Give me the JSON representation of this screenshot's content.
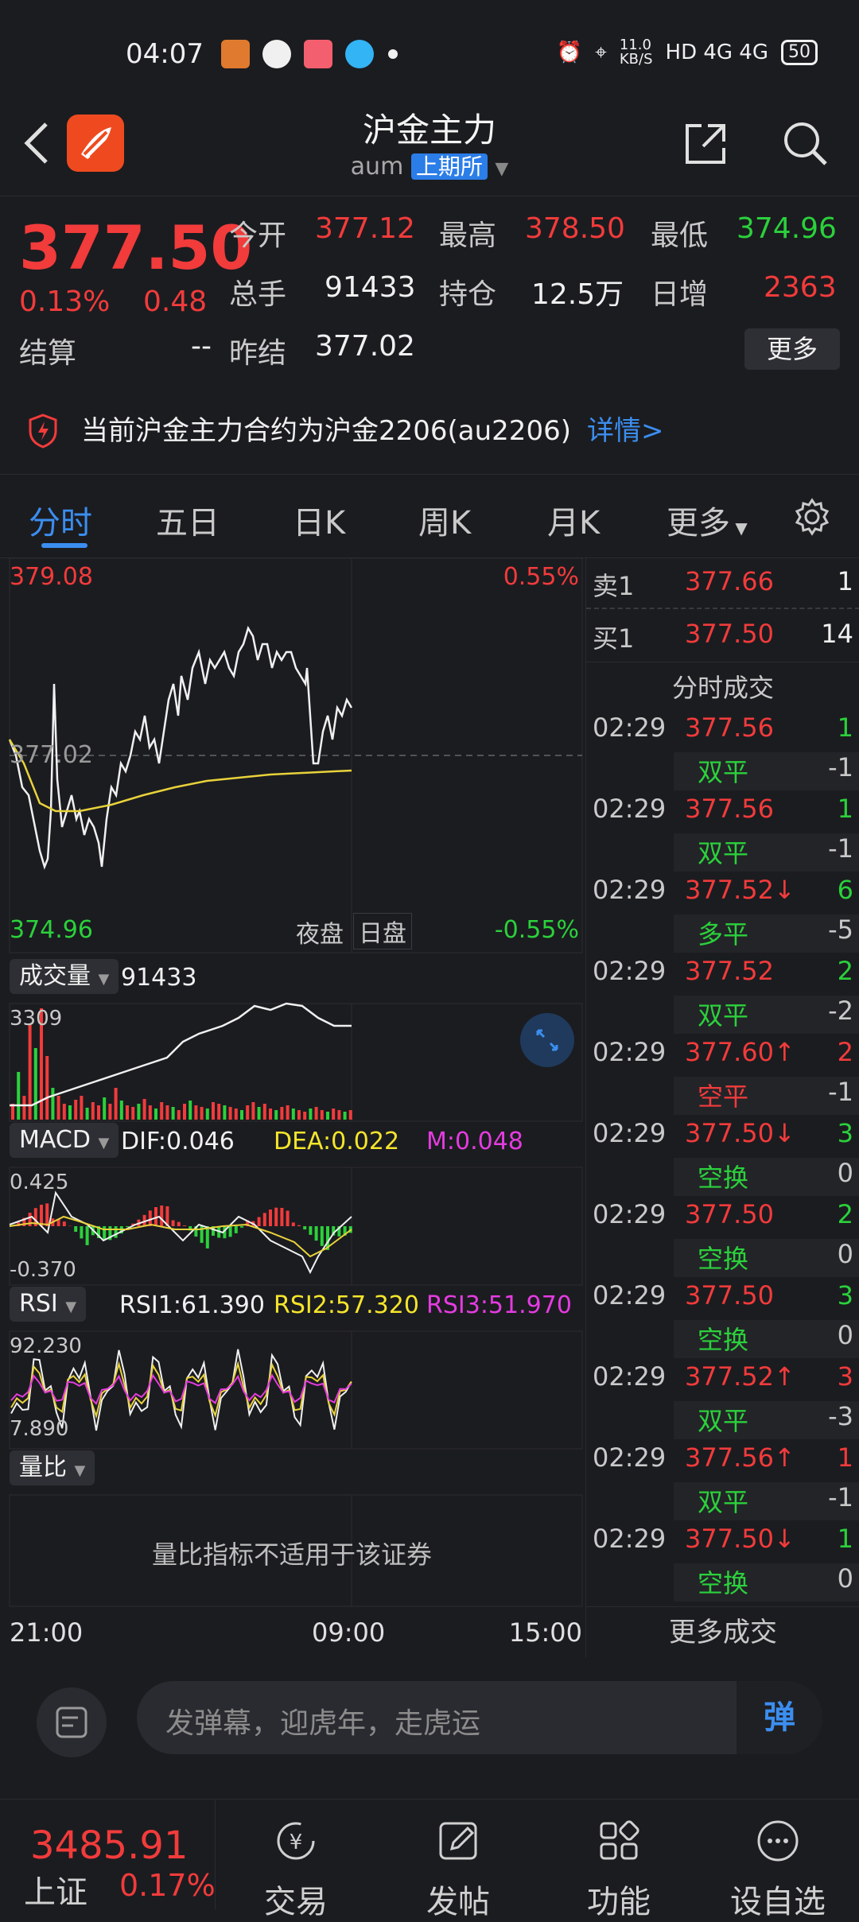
{
  "status_bar": {
    "time": "04:07",
    "speed": "11.0\nKB/S",
    "network": "HD 4G 4G",
    "battery": "50"
  },
  "header": {
    "title": "沪金主力",
    "code": "aum",
    "exchange": "上期所"
  },
  "quote": {
    "price": "377.50",
    "change_pct": "0.13%",
    "change": "0.48",
    "settle_label": "结算",
    "settle_value": "--",
    "open_label": "今开",
    "open": "377.12",
    "high_label": "最高",
    "high": "378.50",
    "low_label": "最低",
    "low": "374.96",
    "volume_label": "总手",
    "volume": "91433",
    "oi_label": "持仓",
    "oi": "12.5万",
    "daily_inc_label": "日增",
    "daily_inc": "2363",
    "prev_settle_label": "昨结",
    "prev_settle": "377.02",
    "more_label": "更多"
  },
  "notice": {
    "text": "当前沪金主力合约为沪金2206(au2206)",
    "link": "详情>"
  },
  "tabs": [
    "分时",
    "五日",
    "日K",
    "周K",
    "月K",
    "更多"
  ],
  "chart": {
    "price_top": "379.08",
    "price_mid": "377.02",
    "price_bottom": "374.96",
    "pct_top": "0.55%",
    "pct_bottom": "-0.55%",
    "night_label": "夜盘",
    "day_label": "日盘",
    "volume_selector": "成交量",
    "volume_value": "91433",
    "volume_max": "3309",
    "macd_selector": "MACD",
    "dif": "DIF:0.046",
    "dea": "DEA:0.022",
    "m": "M:0.048",
    "macd_top": "0.425",
    "macd_bottom": "-0.370",
    "rsi_selector": "RSI",
    "rsi1": "RSI1:61.390",
    "rsi2": "RSI2:57.320",
    "rsi3": "RSI3:51.970",
    "rsi_top": "92.230",
    "rsi_bottom": "7.890",
    "ratio_selector": "量比",
    "ratio_msg": "量比指标不适用于该证券",
    "x_labels": [
      "21:00",
      "09:00",
      "15:00"
    ]
  },
  "orderbook": {
    "sell_label": "卖1",
    "sell_price": "377.66",
    "sell_qty": "1",
    "buy_label": "买1",
    "buy_price": "377.50",
    "buy_qty": "14"
  },
  "trades_title": "分时成交",
  "trades": [
    {
      "time": "02:29",
      "price": "377.56",
      "arrow": "",
      "qty": "1",
      "kind": "双平",
      "chg": "-1"
    },
    {
      "time": "02:29",
      "price": "377.56",
      "arrow": "",
      "qty": "1",
      "kind": "双平",
      "chg": "-1"
    },
    {
      "time": "02:29",
      "price": "377.52",
      "arrow": "↓",
      "qty": "6",
      "kind": "多平",
      "chg": "-5"
    },
    {
      "time": "02:29",
      "price": "377.52",
      "arrow": "",
      "qty": "2",
      "kind": "双平",
      "chg": "-2"
    },
    {
      "time": "02:29",
      "price": "377.60",
      "arrow": "↑",
      "qty": "2",
      "kind": "空平",
      "chg": "-1"
    },
    {
      "time": "02:29",
      "price": "377.50",
      "arrow": "↓",
      "qty": "3",
      "kind": "空换",
      "chg": "0"
    },
    {
      "time": "02:29",
      "price": "377.50",
      "arrow": "",
      "qty": "2",
      "kind": "空换",
      "chg": "0"
    },
    {
      "time": "02:29",
      "price": "377.50",
      "arrow": "",
      "qty": "3",
      "kind": "空换",
      "chg": "0"
    },
    {
      "time": "02:29",
      "price": "377.52",
      "arrow": "↑",
      "qty": "3",
      "kind": "双平",
      "chg": "-3"
    },
    {
      "time": "02:29",
      "price": "377.56",
      "arrow": "↑",
      "qty": "1",
      "kind": "双平",
      "chg": "-1"
    },
    {
      "time": "02:29",
      "price": "377.50",
      "arrow": "↓",
      "qty": "1",
      "kind": "空换",
      "chg": "0"
    }
  ],
  "more_trades": "更多成交",
  "comment": {
    "placeholder": "发弹幕，迎虎年，走虎运",
    "send": "弹"
  },
  "bottom_nav": {
    "index_value": "3485.91",
    "index_name": "上证",
    "index_pct": "0.17%",
    "items": [
      "交易",
      "发帖",
      "功能",
      "设自选"
    ]
  },
  "colors": {
    "up": "#f23b3b",
    "down": "#2bd13b",
    "accent": "#3b8ef0",
    "avg_line": "#e8d23a"
  }
}
